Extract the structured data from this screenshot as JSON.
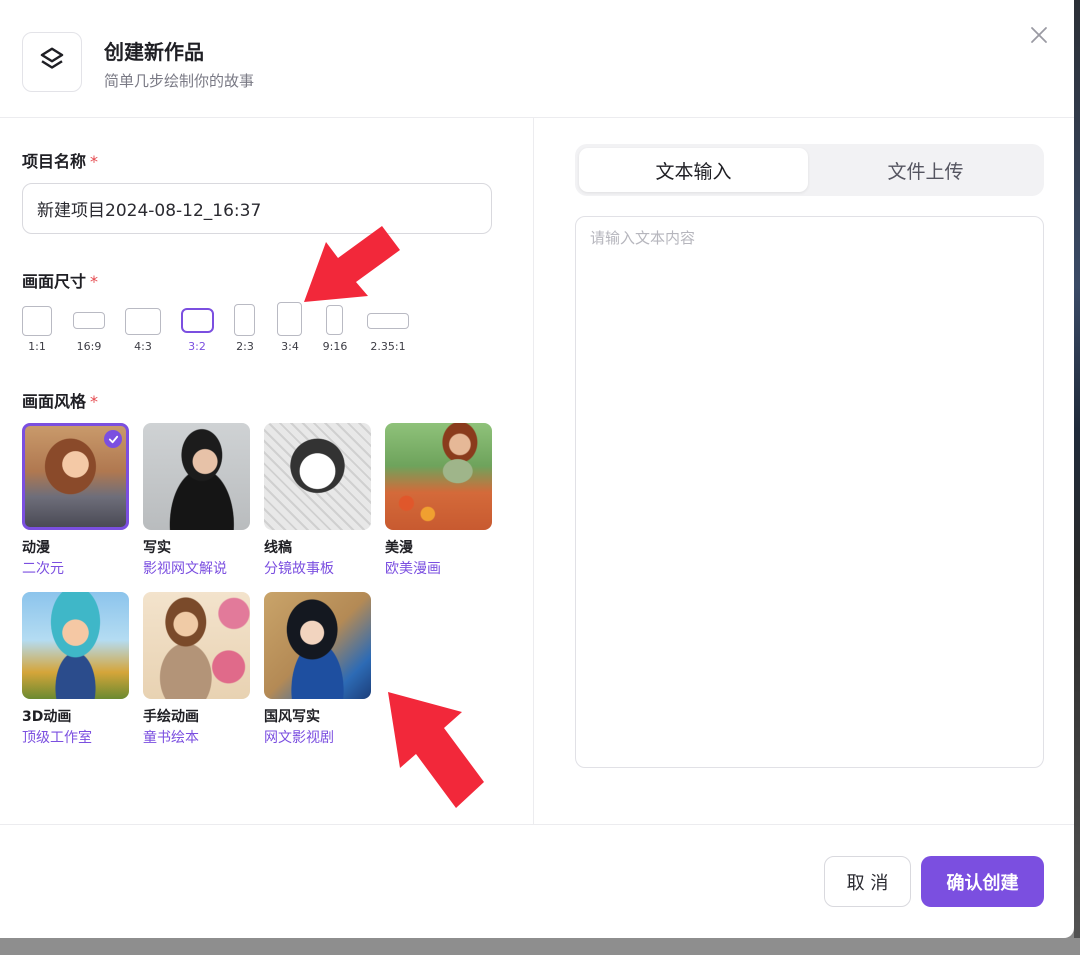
{
  "header": {
    "title": "创建新作品",
    "subtitle": "简单几步绘制你的故事",
    "logo_icon": "layers-icon",
    "close_icon": "close-icon"
  },
  "project_name": {
    "label": "项目名称",
    "required_mark": "*",
    "value": "新建项目2024-08-12_16:37"
  },
  "ratio": {
    "label": "画面尺寸",
    "required_mark": "*",
    "options": [
      "1:1",
      "16:9",
      "4:3",
      "3:2",
      "2:3",
      "3:4",
      "9:16",
      "2.35:1"
    ],
    "selected": "3:2"
  },
  "style": {
    "label": "画面风格",
    "required_mark": "*",
    "selected": "动漫",
    "items": [
      {
        "name": "动漫",
        "desc": "二次元"
      },
      {
        "name": "写实",
        "desc": "影视网文解说"
      },
      {
        "name": "线稿",
        "desc": "分镜故事板"
      },
      {
        "name": "美漫",
        "desc": "欧美漫画"
      },
      {
        "name": "3D动画",
        "desc": "顶级工作室"
      },
      {
        "name": "手绘动画",
        "desc": "童书绘本"
      },
      {
        "name": "国风写实",
        "desc": "网文影视剧"
      }
    ]
  },
  "tabs": [
    {
      "label": "文本输入",
      "active": true
    },
    {
      "label": "文件上传",
      "active": false
    }
  ],
  "text_input": {
    "placeholder": "请输入文本内容"
  },
  "footer": {
    "cancel_label": "取 消",
    "confirm_label": "确认创建"
  },
  "colors": {
    "accent": "#7b4fe0",
    "required": "#e5484d",
    "annotation_arrow": "#f2283a"
  }
}
